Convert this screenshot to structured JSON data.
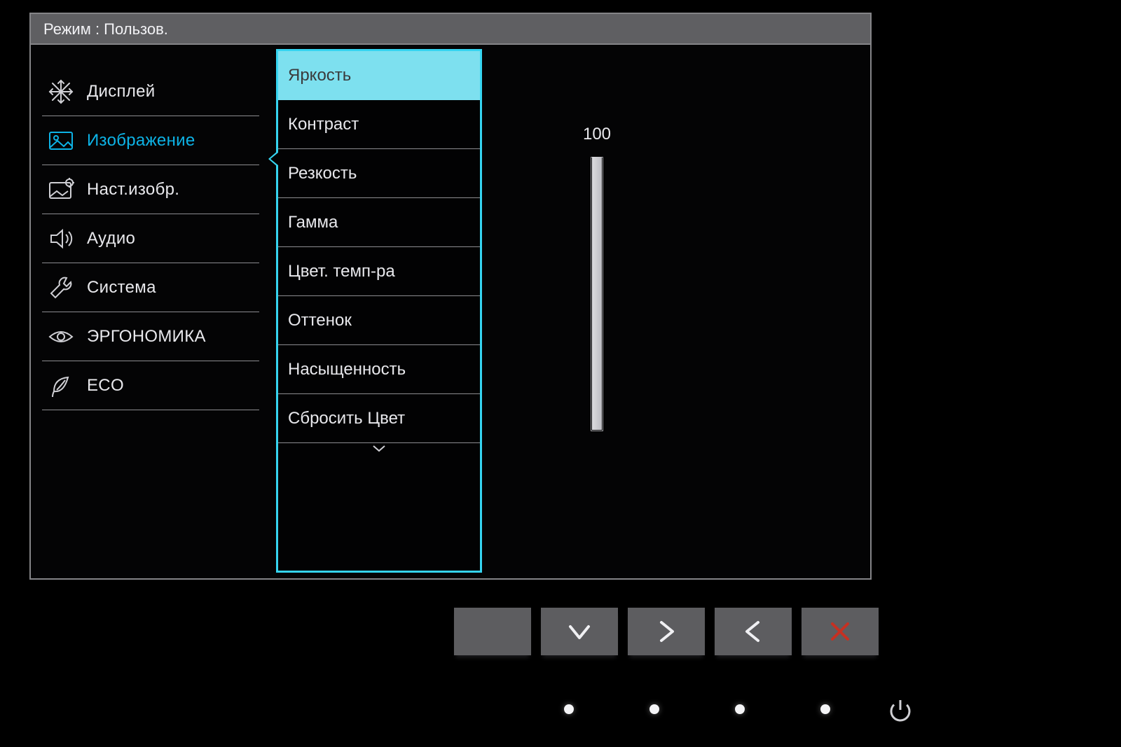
{
  "colors": {
    "accent": "#35d4f0",
    "accent_text": "#0db3e6"
  },
  "title": "Режим : Пользов.",
  "sidebar": {
    "items": [
      {
        "label": "Дисплей",
        "icon": "snowflake-icon"
      },
      {
        "label": "Изображение",
        "icon": "picture-icon"
      },
      {
        "label": "Наст.изобр.",
        "icon": "picture-gear-icon"
      },
      {
        "label": "Аудио",
        "icon": "speaker-icon"
      },
      {
        "label": "Система",
        "icon": "wrench-icon"
      },
      {
        "label": "ЭРГОНОМИКА",
        "icon": "eye-icon"
      },
      {
        "label": "ECO",
        "icon": "leaf-icon"
      }
    ],
    "active_index": 1
  },
  "submenu": {
    "items": [
      "Яркость",
      "Контраст",
      "Резкость",
      "Гамма",
      "Цвет. темп-ра",
      "Оттенок",
      "Насыщенность",
      "Сбросить Цвет"
    ],
    "highlight_index": 0,
    "has_more_below": true
  },
  "value": {
    "number": "100",
    "percent": 100
  },
  "hw_buttons": [
    {
      "name": "blank-button",
      "glyph": ""
    },
    {
      "name": "down-button",
      "glyph": "v"
    },
    {
      "name": "right-button",
      "glyph": ">"
    },
    {
      "name": "left-button",
      "glyph": "<"
    },
    {
      "name": "close-button",
      "glyph": "x"
    }
  ],
  "bezel": {
    "led_count": 4
  }
}
